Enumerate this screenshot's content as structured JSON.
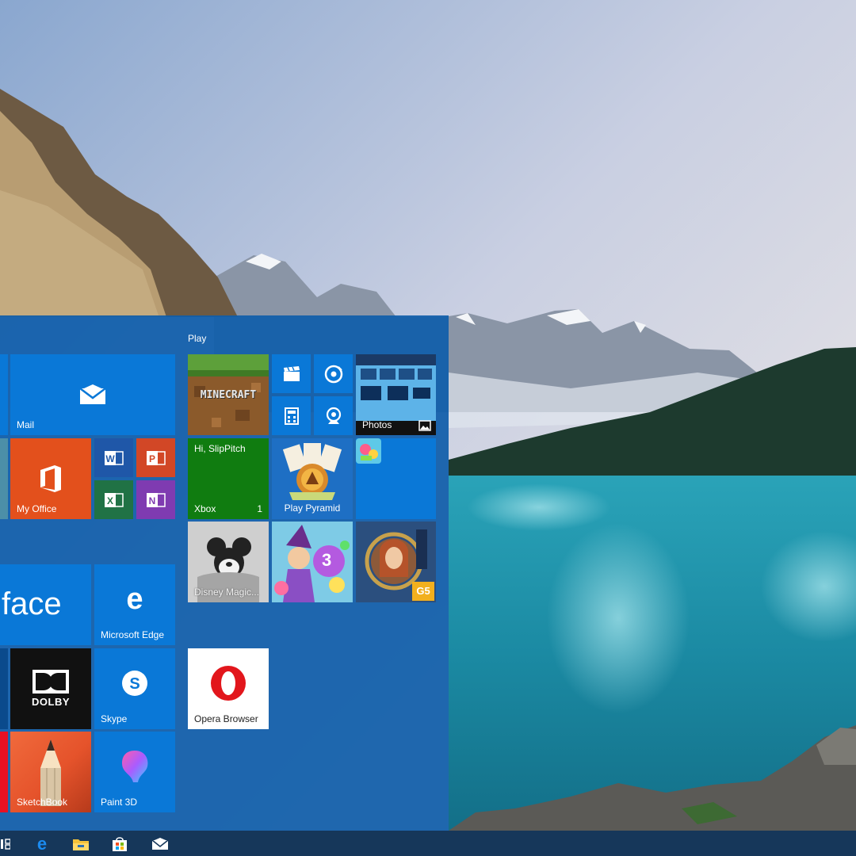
{
  "start_menu": {
    "group_play": "Play",
    "tiles": {
      "mail": {
        "label": "Mail",
        "icon": "mail-icon"
      },
      "my_office": {
        "label": "My Office",
        "icon": "office-icon"
      },
      "word": {
        "icon": "word-icon"
      },
      "powerpoint": {
        "icon": "powerpoint-icon"
      },
      "excel": {
        "icon": "excel-icon"
      },
      "onenote": {
        "icon": "onenote-icon"
      },
      "surface": {
        "text": "face"
      },
      "microsoft_edge": {
        "label": "Microsoft Edge",
        "icon": "edge-icon"
      },
      "dolby": {
        "text": "DOLBY"
      },
      "skype": {
        "label": "Skype",
        "icon": "skype-icon"
      },
      "sketchbook": {
        "label": "SketchBook",
        "icon": "pencil-icon"
      },
      "paint_3d": {
        "label": "Paint 3D",
        "icon": "paint3d-icon"
      },
      "minecraft": {
        "text": "MINECRAFT"
      },
      "movies_tv": {
        "icon": "clapper-icon"
      },
      "groove": {
        "icon": "disc-icon"
      },
      "calculator": {
        "icon": "calculator-icon"
      },
      "camera": {
        "icon": "webcam-icon"
      },
      "photos": {
        "label": "Photos",
        "icon": "photo-icon"
      },
      "xbox": {
        "greeting": "Hi, SlipPitch",
        "label": "Xbox",
        "count": "1"
      },
      "play_pyramid": {
        "label": "Play Pyramid"
      },
      "soda_app": {
        "icon": "candy-icon"
      },
      "disney": {
        "label": "Disney Magic..."
      },
      "bubble_witch": {
        "badge": "3"
      },
      "hidden_city": {
        "badge": "G5"
      },
      "opera": {
        "label": "Opera Browser"
      }
    }
  },
  "taskbar": {
    "items": [
      "task-view-icon",
      "edge-icon",
      "file-explorer-icon",
      "store-icon",
      "mail-icon"
    ]
  },
  "colors": {
    "tile_blue": "#0a78d7",
    "office_orange": "#e3501c",
    "xbox_green": "#107c10",
    "onenote_purple": "#7f3bb1",
    "excel_green": "#207245",
    "ppt_orange": "#d24726"
  }
}
